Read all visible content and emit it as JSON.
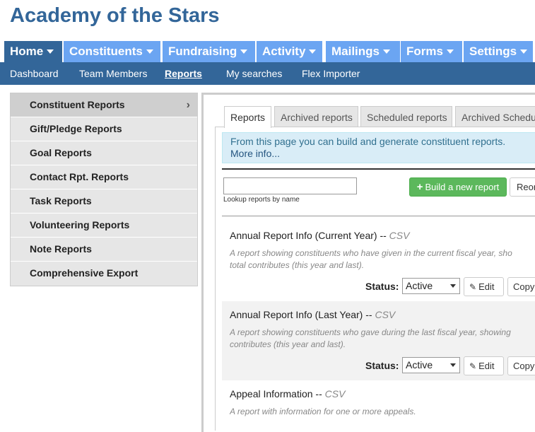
{
  "app_title": "Academy of the Stars",
  "top_nav": [
    {
      "label": "Home",
      "active": true
    },
    {
      "label": "Constituents"
    },
    {
      "label": "Fundraising"
    },
    {
      "label": "Activity"
    },
    {
      "label": "Mailings"
    },
    {
      "label": "Forms"
    },
    {
      "label": "Settings"
    }
  ],
  "sub_nav": [
    {
      "label": "Dashboard"
    },
    {
      "label": "Team Members"
    },
    {
      "label": "Reports",
      "active": true
    },
    {
      "label": "My searches"
    },
    {
      "label": "Flex Importer"
    }
  ],
  "sidebar": {
    "items": [
      {
        "label": "Constituent Reports",
        "active": true
      },
      {
        "label": "Gift/Pledge Reports"
      },
      {
        "label": "Goal Reports"
      },
      {
        "label": "Contact Rpt. Reports"
      },
      {
        "label": "Task Reports"
      },
      {
        "label": "Volunteering Reports"
      },
      {
        "label": "Note Reports"
      },
      {
        "label": "Comprehensive Export"
      }
    ],
    "active_chevron": "›"
  },
  "report_tabs": [
    {
      "label": "Reports",
      "active": true
    },
    {
      "label": "Archived reports"
    },
    {
      "label": "Scheduled reports"
    },
    {
      "label": "Archived Schedu"
    }
  ],
  "info": {
    "text": "From this page you can build and generate constituent reports.",
    "link": "More info..."
  },
  "lookup": {
    "value": "",
    "label": "Lookup reports by name"
  },
  "buttons": {
    "build": "Build a new report",
    "build_icon": "+",
    "reorder": "Reor"
  },
  "reports": [
    {
      "title": "Annual Report Info (Current Year) --",
      "format": "CSV",
      "desc_lines": [
        "A report showing constituents who have given in the current fiscal year, sho",
        "total contributes (this year and last)."
      ],
      "status_label": "Status:",
      "status_value": "Active",
      "edit_label": "Edit",
      "copy_label": "Copy"
    },
    {
      "title": "Annual Report Info (Last Year) --",
      "format": "CSV",
      "desc_lines": [
        "A report showing constituents who gave during the last fiscal year, showing",
        "contributes (this year and last)."
      ],
      "status_label": "Status:",
      "status_value": "Active",
      "edit_label": "Edit",
      "copy_label": "Copy"
    },
    {
      "title": "Appeal Information --",
      "format": "CSV",
      "desc_lines": [
        "A report with information for one or more appeals."
      ]
    }
  ],
  "colors": {
    "brand": "#336699",
    "nav_tab": "#6ba5f2",
    "success": "#5cb85c",
    "info_bg": "#d9edf7"
  }
}
